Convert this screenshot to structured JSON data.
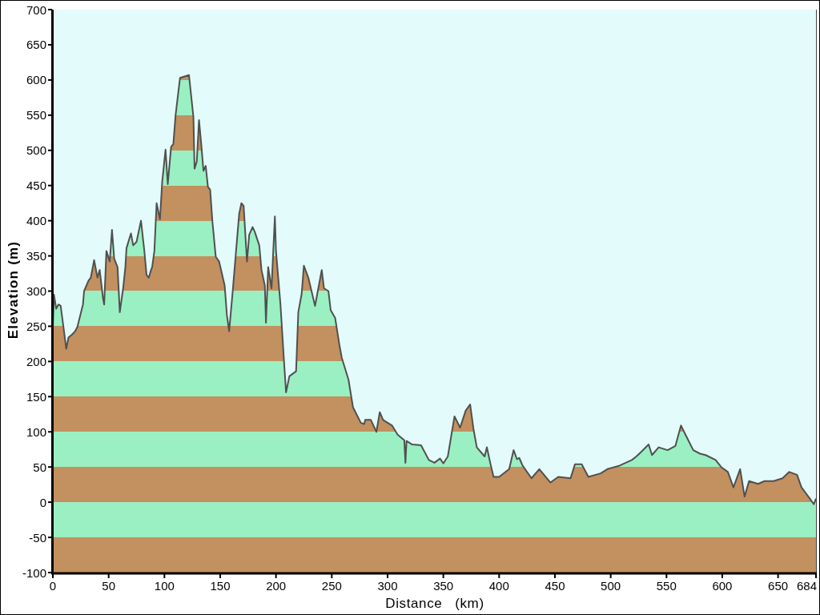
{
  "chart_data": {
    "type": "area",
    "xlabel": "Distance   (km)",
    "ylabel": "Elevation (m)",
    "x": [
      0,
      1,
      3,
      5,
      7,
      10,
      12,
      14,
      17,
      20,
      22,
      24,
      27,
      28,
      32,
      34,
      37,
      40,
      42,
      45,
      46,
      48,
      51,
      53,
      55,
      58,
      60,
      63,
      65,
      66,
      70,
      72,
      75,
      79,
      82,
      84,
      86,
      88,
      89,
      91,
      93,
      96,
      98,
      101,
      103,
      106,
      108,
      110,
      114,
      122,
      126,
      127,
      129,
      131,
      133,
      135,
      137,
      139,
      141,
      143,
      146,
      149,
      154,
      156,
      158,
      161,
      163,
      167,
      169,
      171,
      174,
      176,
      179,
      181,
      185,
      187,
      190,
      191,
      193,
      196,
      199,
      200,
      204,
      207,
      209,
      212,
      218,
      220,
      223,
      225,
      229,
      235,
      237,
      241,
      243,
      247,
      249,
      253,
      257,
      259,
      265,
      269,
      276,
      279,
      280,
      285,
      290,
      293,
      296,
      304,
      309,
      315,
      316,
      317,
      322,
      330,
      337,
      342,
      347,
      350,
      354,
      360,
      365,
      370,
      374,
      377,
      380,
      387,
      389,
      392,
      395,
      400,
      409,
      413,
      416,
      418,
      421,
      429,
      436,
      446,
      453,
      464,
      468,
      474,
      480,
      491,
      497,
      508,
      519,
      523,
      527,
      534,
      537,
      543,
      551,
      558,
      563,
      567,
      574,
      580,
      585,
      594,
      599,
      605,
      610,
      616,
      620,
      624,
      632,
      638,
      646,
      654,
      660,
      667,
      671,
      679,
      682,
      684
    ],
    "values": [
      250,
      295,
      275,
      281,
      279,
      243,
      218,
      234,
      238,
      243,
      249,
      262,
      281,
      300,
      315,
      319,
      344,
      319,
      330,
      289,
      281,
      357,
      342,
      387,
      346,
      334,
      270,
      304,
      334,
      361,
      382,
      365,
      370,
      400,
      357,
      323,
      319,
      330,
      334,
      357,
      425,
      402,
      455,
      501,
      452,
      505,
      509,
      550,
      603,
      607,
      547,
      474,
      484,
      543,
      509,
      471,
      478,
      448,
      444,
      399,
      349,
      342,
      308,
      266,
      243,
      296,
      334,
      410,
      425,
      421,
      342,
      380,
      391,
      384,
      365,
      330,
      308,
      255,
      334,
      304,
      406,
      357,
      281,
      205,
      156,
      179,
      186,
      270,
      296,
      336,
      319,
      279,
      296,
      330,
      304,
      300,
      273,
      262,
      222,
      205,
      174,
      135,
      113,
      111,
      117,
      117,
      100,
      128,
      117,
      109,
      96,
      88,
      56,
      87,
      82,
      81,
      60,
      56,
      62,
      55,
      65,
      122,
      106,
      130,
      139,
      104,
      78,
      65,
      78,
      56,
      36,
      36,
      47,
      74,
      61,
      63,
      52,
      34,
      47,
      28,
      36,
      34,
      54,
      54,
      36,
      41,
      47,
      52,
      60,
      65,
      71,
      82,
      67,
      78,
      74,
      80,
      109,
      96,
      74,
      69,
      67,
      60,
      50,
      43,
      21,
      47,
      8,
      30,
      26,
      30,
      30,
      34,
      43,
      39,
      21,
      4,
      -3,
      5
    ],
    "xlim": [
      0,
      684
    ],
    "ylim": [
      -100,
      700
    ],
    "xticks": [
      0,
      50,
      100,
      150,
      200,
      250,
      300,
      350,
      400,
      450,
      500,
      550,
      600,
      650,
      684
    ],
    "yticks": [
      -100,
      -50,
      0,
      50,
      100,
      150,
      200,
      250,
      300,
      350,
      400,
      450,
      500,
      550,
      600,
      650,
      700
    ]
  }
}
